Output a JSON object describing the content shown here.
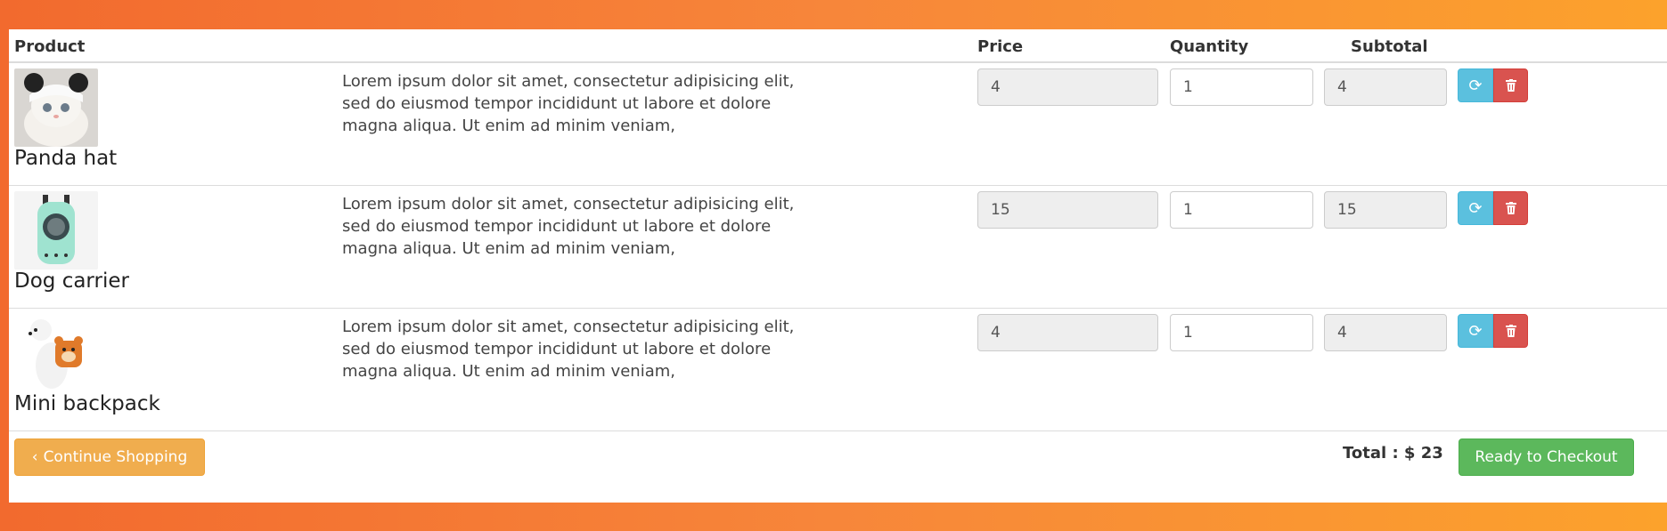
{
  "table": {
    "headers": {
      "product": "Product",
      "price": "Price",
      "quantity": "Quantity",
      "subtotal": "Subtotal"
    },
    "rows": [
      {
        "name": "Panda hat",
        "image": "cat-in-panda-hat-photo",
        "description": "Lorem ipsum dolor sit amet, consectetur adipisicing elit, sed do eiusmod tempor incididunt ut labore et dolore magna aliqua. Ut enim ad minim veniam,",
        "price": "4",
        "quantity": "1",
        "subtotal": "4"
      },
      {
        "name": "Dog carrier",
        "image": "mint-pet-carrier-backpack-photo",
        "description": "Lorem ipsum dolor sit amet, consectetur adipisicing elit, sed do eiusmod tempor incididunt ut labore et dolore magna aliqua. Ut enim ad minim veniam,",
        "price": "15",
        "quantity": "1",
        "subtotal": "15"
      },
      {
        "name": "Mini backpack",
        "image": "dog-with-bear-backpack-photo",
        "description": "Lorem ipsum dolor sit amet, consectetur adipisicing elit, sed do eiusmod tempor incididunt ut labore et dolore magna aliqua. Ut enim ad minim veniam,",
        "price": "4",
        "quantity": "1",
        "subtotal": "4"
      }
    ]
  },
  "footer": {
    "continue_label": "Continue Shopping",
    "total_label": "Total : $ 23",
    "checkout_label": "Ready to Checkout"
  },
  "icons": {
    "refresh": "refresh-icon",
    "delete": "trash-icon",
    "continue": "chevron-left-icon"
  },
  "colors": {
    "info": "#5bc0de",
    "danger": "#d9534f",
    "warning": "#f0ad4e",
    "success": "#5cb85c",
    "background_start": "#f26a2e",
    "background_end": "#fca22c"
  }
}
